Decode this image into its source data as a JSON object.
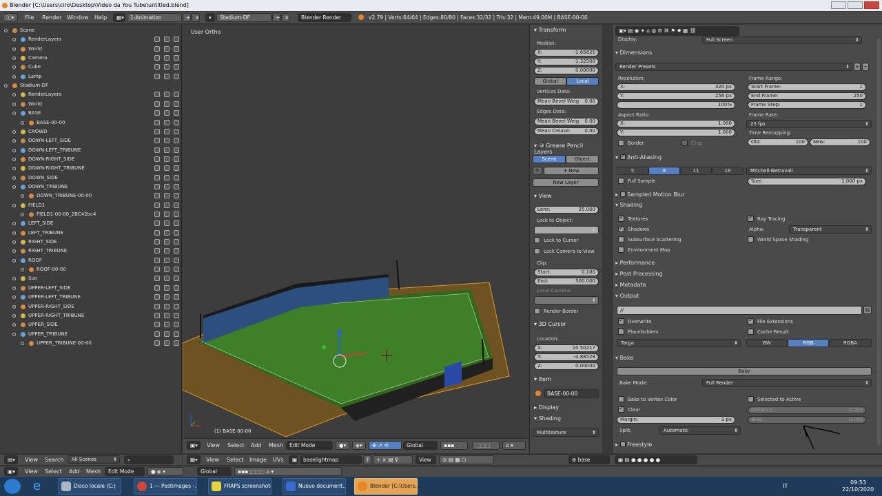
{
  "window": {
    "title": "Blender [C:\\Users\\ciro\\Desktop\\Video da You Tube\\untitled.blend]"
  },
  "topbar": {
    "menus": [
      "File",
      "Render",
      "Window",
      "Help"
    ],
    "layout": "1-Animation",
    "scene": "Stadium-DF",
    "engine": "Blender Render",
    "stats": "v2.79 | Verts:64/64 | Edges:80/80 | Faces:32/32 | Tris:32 | Mem:49.00M | BASE-00-00"
  },
  "outliner": {
    "rows": [
      {
        "label": "Scene",
        "depth": 0
      },
      {
        "label": "RenderLayers",
        "depth": 1
      },
      {
        "label": "World",
        "depth": 1
      },
      {
        "label": "Camera",
        "depth": 1
      },
      {
        "label": "Cube",
        "depth": 1
      },
      {
        "label": "Lamp",
        "depth": 1
      },
      {
        "label": "Stadium-DF",
        "depth": 0
      },
      {
        "label": "RenderLayers",
        "depth": 1
      },
      {
        "label": "World",
        "depth": 1
      },
      {
        "label": "BASE",
        "depth": 1
      },
      {
        "label": "BASE-00-00",
        "depth": 2
      },
      {
        "label": "CROWD",
        "depth": 1
      },
      {
        "label": "DOWN-LEFT_SIDE",
        "depth": 1
      },
      {
        "label": "DOWN-LEFT_TRIBUNE",
        "depth": 1
      },
      {
        "label": "DOWN-RIGHT_SIDE",
        "depth": 1
      },
      {
        "label": "DOWN-RIGHT_TRIBUNE",
        "depth": 1
      },
      {
        "label": "DOWN_SIDE",
        "depth": 1
      },
      {
        "label": "DOWN_TRIBUNE",
        "depth": 1
      },
      {
        "label": "DOWN_TRIBUNE-00-00",
        "depth": 2
      },
      {
        "label": "FIELD1",
        "depth": 1
      },
      {
        "label": "FIELD1-00-00_2BC42bc4",
        "depth": 2
      },
      {
        "label": "LEFT_SIDE",
        "depth": 1
      },
      {
        "label": "LEFT_TRIBUNE",
        "depth": 1
      },
      {
        "label": "RIGHT_SIDE",
        "depth": 1
      },
      {
        "label": "RIGHT_TRIBUNE",
        "depth": 1
      },
      {
        "label": "ROOF",
        "depth": 1
      },
      {
        "label": "ROOF-00-00",
        "depth": 2
      },
      {
        "label": "Sun",
        "depth": 1
      },
      {
        "label": "UPPER-LEFT_SIDE",
        "depth": 1
      },
      {
        "label": "UPPER-LEFT_TRIBUNE",
        "depth": 1
      },
      {
        "label": "UPPER-RIGHT_SIDE",
        "depth": 1
      },
      {
        "label": "UPPER-RIGHT_TRIBUNE",
        "depth": 1
      },
      {
        "label": "UPPER_SIDE",
        "depth": 1
      },
      {
        "label": "UPPER_TRIBUNE",
        "depth": 1
      },
      {
        "label": "UPPER_TRIBUNE-00-00",
        "depth": 2
      }
    ],
    "footer": {
      "view": "View",
      "search": "Search",
      "filter": "All Scenes"
    }
  },
  "viewport": {
    "label": "User Ortho",
    "object_label": "(1) BASE-00-00",
    "header": {
      "view": "View",
      "select": "Select",
      "add": "Add",
      "mesh": "Mesh",
      "mode": "Edit Mode",
      "orientation": "Global"
    }
  },
  "npanel": {
    "transform": "Transform",
    "median": "Median:",
    "x": {
      "k": "X:",
      "v": "-1.65625"
    },
    "y": {
      "k": "Y:",
      "v": "-1.32500"
    },
    "z": {
      "k": "Z:",
      "v": "0.00000"
    },
    "global": "Global",
    "local": "Local",
    "vertices_data": "Vertices Data:",
    "mean_bevel_v": {
      "k": "Mean Bevel Weig",
      "v": "0.00"
    },
    "edges_data": "Edges Data:",
    "mean_bevel_e": {
      "k": "Mean Bevel Weig",
      "v": "0.00"
    },
    "mean_crease": {
      "k": "Mean Crease:",
      "v": "0.00"
    },
    "grease": "Grease Pencil Layers",
    "scene": "Scene",
    "object": "Object",
    "new": "New",
    "new_layer": "New Layer",
    "view": "View",
    "lens": {
      "k": "Lens:",
      "v": "35.000"
    },
    "lock_to_object": "Lock to Object:",
    "lock_cursor": "Lock to Cursor",
    "lock_camera": "Lock Camera to View",
    "clip": "Clip:",
    "start": {
      "k": "Start:",
      "v": "0.100"
    },
    "end": {
      "k": "End:",
      "v": "500.000"
    },
    "local_camera": "Local Camera:",
    "render_border": "Render Border",
    "cursor": "3D Cursor",
    "location": "Location:",
    "cx": {
      "k": "X:",
      "v": "10.50217"
    },
    "cy": {
      "k": "Y:",
      "v": "-4.88528"
    },
    "cz": {
      "k": "Z:",
      "v": "0.00000"
    },
    "item": "Item",
    "item_name": "BASE-00-00",
    "display": "Display",
    "shading": "Shading",
    "multitexture": "Multitexture"
  },
  "props": {
    "display_label": "Display:",
    "display_value": "Full Screen",
    "dimensions": "Dimensions",
    "render_presets": "Render Presets",
    "resolution": "Resolution:",
    "res_x": {
      "k": "X:",
      "v": "320 px"
    },
    "res_y": {
      "k": "Y:",
      "v": "256 px"
    },
    "res_pct": "100%",
    "frame_range": "Frame Range:",
    "start_frame": {
      "k": "Start Frame:",
      "v": "1"
    },
    "end_frame": {
      "k": "End Frame:",
      "v": "250"
    },
    "frame_step": {
      "k": "Frame Step:",
      "v": "1"
    },
    "aspect": "Aspect Ratio:",
    "asp_x": {
      "k": "X:",
      "v": "1.000"
    },
    "asp_y": {
      "k": "Y:",
      "v": "1.000"
    },
    "frame_rate": "Frame Rate:",
    "fps": "25 fps",
    "time_remap": "Time Remapping:",
    "old": {
      "k": "Old:",
      "v": "100"
    },
    "new": {
      "k": "New:",
      "v": "100"
    },
    "border": "Border",
    "crop": "Crop",
    "anti_aliasing": "Anti-Aliasing",
    "aa_5": "5",
    "aa_8": "8",
    "aa_11": "11",
    "aa_16": "16",
    "filter": "Mitchell-Netravali",
    "full_sample": "Full Sample",
    "size": {
      "k": "Size:",
      "v": "1.000 px"
    },
    "motion_blur": "Sampled Motion Blur",
    "shading": "Shading",
    "textures": "Textures",
    "ray_tracing": "Ray Tracing",
    "shadows": "Shadows",
    "alpha": "Alpha:",
    "alpha_value": "Transparent",
    "sss": "Subsurface Scattering",
    "world_space": "World Space Shading",
    "env_map": "Environment Map",
    "performance": "Performance",
    "post_processing": "Post Processing",
    "metadata": "Metadata",
    "output": "Output",
    "output_path": "//",
    "overwrite": "Overwrite",
    "file_ext": "File Extensions",
    "placeholders": "Placeholders",
    "cache_result": "Cache Result",
    "format": "Targa",
    "bw": "BW",
    "rgb": "RGB",
    "rgba": "RGBA",
    "bake": "Bake",
    "bake_button": "Bake",
    "bake_mode_label": "Bake Mode:",
    "bake_mode": "Full Render",
    "bake_vc": "Bake to Vertex Color",
    "sel_active": "Selected to Active",
    "clear": "Clear",
    "distance": {
      "k": "Distance:",
      "v": "0.000"
    },
    "margin": {
      "k": "Margin:",
      "v": "3 px"
    },
    "bias": {
      "k": "Bias:",
      "v": "0.000"
    },
    "split": "Split:",
    "split_value": "Automatic",
    "freestyle": "Freestyle"
  },
  "uvheader": {
    "view": "View",
    "select": "Select",
    "image": "Image",
    "uvs": "UVs",
    "image_name": "baselightmap",
    "f": "F",
    "view2": "View",
    "material": "base"
  },
  "bottombar": {
    "view": "View",
    "select": "Select",
    "add": "Add",
    "mesh": "Mesh",
    "mode": "Edit Mode",
    "global": "Global"
  },
  "taskbar": {
    "items": [
      "Disco locale (C:)",
      "1 — Postimages -...",
      "FRAPS screenshots",
      "Nuovo document...",
      "Blender [C:\\Users..."
    ],
    "lang": "IT",
    "time": "09:53",
    "date": "22/10/2020"
  }
}
